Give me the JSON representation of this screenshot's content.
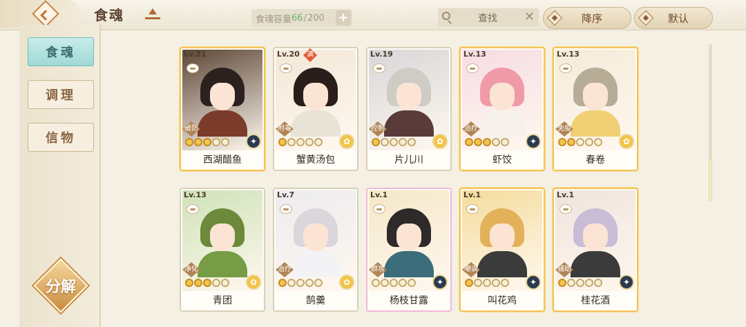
{
  "header": {
    "title": "食魂",
    "capacity": {
      "label": "食魂容量",
      "current": "66",
      "max": "200"
    },
    "search": {
      "label": "查找"
    },
    "sort": {
      "order_label": "降序",
      "mode_label": "默认"
    }
  },
  "sidebar": {
    "items": [
      {
        "label": "食魂",
        "active": true
      },
      {
        "label": "调理",
        "active": false
      },
      {
        "label": "信物",
        "active": false
      }
    ],
    "decompose_label": "分解"
  },
  "cards": [
    {
      "level": "Lv.21",
      "name": "西湖醋鱼",
      "role": "破防",
      "stars": 3,
      "element": "dark",
      "element_icon": "gear-icon",
      "art": "#5d4737",
      "hair": "#2b2220",
      "body": "#7b3b2a",
      "frame": "gold"
    },
    {
      "level": "Lv.20",
      "name": "蟹黄汤包",
      "role": "附毒",
      "stars": 1,
      "element": "yellow",
      "element_icon": "flower-icon",
      "art": "#f3e8d8",
      "hair": "#2a1e1b",
      "body": "#e9e2d6",
      "frame": "plain",
      "full_tag": "满"
    },
    {
      "level": "Lv.19",
      "name": "片儿川",
      "role": "控制",
      "stars": 1,
      "element": "yellow",
      "element_icon": "flower-icon",
      "art": "#d8d6d8",
      "hair": "#cfccc6",
      "body": "#5b3b3a",
      "frame": "plain"
    },
    {
      "level": "Lv.13",
      "name": "虾饺",
      "role": "治疗",
      "stars": 3,
      "element": "dark",
      "element_icon": "gear-icon",
      "art": "#f6dce3",
      "hair": "#f09aa8",
      "body": "#f7f1ee",
      "frame": "gold"
    },
    {
      "level": "Lv.13",
      "name": "春卷",
      "role": "免疫",
      "stars": 2,
      "element": "yellow",
      "element_icon": "flower-icon",
      "art": "#f4ebd9",
      "hair": "#b7ad97",
      "body": "#f1cf74",
      "frame": "gold"
    },
    {
      "level": "Lv.13",
      "name": "青团",
      "role": "净化",
      "stars": 3,
      "element": "yellow",
      "element_icon": "flower-icon",
      "art": "#cfe2b8",
      "hair": "#6c8a3a",
      "body": "#769c45",
      "frame": "plain"
    },
    {
      "level": "Lv.7",
      "name": "鹄羹",
      "role": "治疗",
      "stars": 1,
      "element": "yellow",
      "element_icon": "flower-icon",
      "art": "#ecebef",
      "hair": "#d9d6dc",
      "body": "#f3f2f4",
      "frame": "plain"
    },
    {
      "level": "Lv.1",
      "name": "杨枝甘露",
      "role": "群攻",
      "stars": 0,
      "element": "dark",
      "element_icon": "gear-icon",
      "art": "#f5e7c8",
      "hair": "#2e2a29",
      "body": "#3b6d7a",
      "frame": "rainbow"
    },
    {
      "level": "Lv.1",
      "name": "叫花鸡",
      "role": "嘲讽",
      "stars": 1,
      "element": "dark",
      "element_icon": "gear-icon",
      "art": "#f4dc9c",
      "hair": "#e2b15a",
      "body": "#3b3b3b",
      "frame": "gold"
    },
    {
      "level": "Lv.1",
      "name": "桂花酒",
      "role": "辅助",
      "stars": 1,
      "element": "dark",
      "element_icon": "gear-icon",
      "art": "#efe4dd",
      "hair": "#c8bcd6",
      "body": "#3b3b3b",
      "frame": "gold"
    }
  ]
}
